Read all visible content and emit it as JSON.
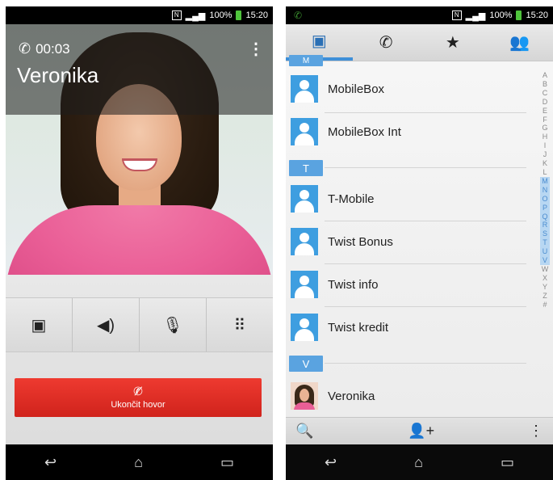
{
  "left_phone": {
    "status": {
      "nfc": "N",
      "signal": "▂▄▆",
      "battery_text": "100%",
      "time": "15:20"
    },
    "call": {
      "timer": "00:03",
      "caller": "Veronika",
      "menu_icon": "overflow-icon"
    },
    "controls": [
      {
        "name": "contacts-button",
        "glyph": "▣",
        "icon": "contacts-icon"
      },
      {
        "name": "speaker-button",
        "glyph": "◀)",
        "icon": "speaker-icon"
      },
      {
        "name": "mute-button",
        "glyph": "🎙",
        "icon": "mic-off-icon"
      },
      {
        "name": "dialpad-button",
        "glyph": "⠿",
        "icon": "dialpad-icon"
      }
    ],
    "end_call_label": "Ukončit hovor",
    "nav": {
      "back": "↩",
      "home": "⌂",
      "recent": "▭"
    }
  },
  "right_phone": {
    "status": {
      "nfc": "N",
      "signal": "▂▄▆",
      "battery_text": "100%",
      "time": "15:20"
    },
    "tabs": [
      {
        "id": "contacts",
        "glyph": "▣",
        "icon": "contacts-icon",
        "active": true
      },
      {
        "id": "calls",
        "glyph": "✆",
        "icon": "phone-icon",
        "active": false
      },
      {
        "id": "favorites",
        "glyph": "★",
        "icon": "star-icon",
        "active": false
      },
      {
        "id": "groups",
        "glyph": "👥",
        "icon": "groups-icon",
        "active": false
      }
    ],
    "section_top": "M",
    "section_t": "T",
    "section_v": "V",
    "contacts": [
      {
        "name": "MobileBox"
      },
      {
        "name": "MobileBox Int"
      },
      {
        "name": "T-Mobile"
      },
      {
        "name": "Twist Bonus"
      },
      {
        "name": "Twist info"
      },
      {
        "name": "Twist kredit"
      },
      {
        "name": "Veronika"
      }
    ],
    "alphabet": [
      "A",
      "B",
      "C",
      "D",
      "E",
      "F",
      "G",
      "H",
      "I",
      "J",
      "K",
      "L",
      "M",
      "N",
      "O",
      "P",
      "Q",
      "R",
      "S",
      "T",
      "U",
      "V",
      "W",
      "X",
      "Y",
      "Z",
      "#"
    ],
    "highlighted_letters": [
      "M",
      "N",
      "O",
      "P",
      "Q",
      "R",
      "S",
      "T",
      "U",
      "V"
    ],
    "bottom": {
      "search": "🔍",
      "add_contact": "👤+",
      "menu": "⋮"
    },
    "nav": {
      "back": "↩",
      "home": "⌂",
      "recent": "▭"
    },
    "accent_color": "#3e8fd8"
  }
}
